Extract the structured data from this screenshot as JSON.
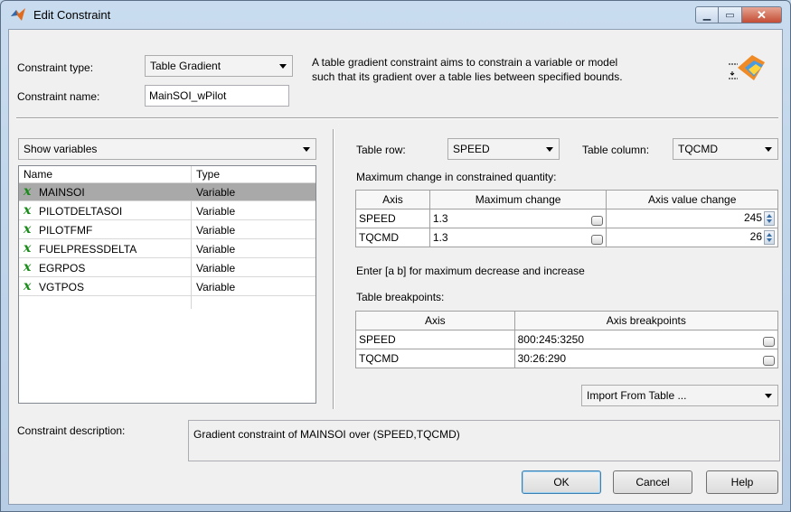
{
  "window": {
    "title": "Edit Constraint"
  },
  "header": {
    "constraint_type_label": "Constraint type:",
    "constraint_type_value": "Table Gradient",
    "constraint_name_label": "Constraint name:",
    "constraint_name_value": "MainSOI_wPilot",
    "description_line1": "A table gradient constraint aims to constrain a variable or model",
    "description_line2": "such that its gradient over a table lies between specified bounds."
  },
  "left_panel": {
    "filter_value": "Show variables",
    "columns": [
      "Name",
      "Type"
    ],
    "variables": [
      {
        "name": "MAINSOI",
        "type": "Variable",
        "selected": true
      },
      {
        "name": "PILOTDELTASOI",
        "type": "Variable"
      },
      {
        "name": "PILOTFMF",
        "type": "Variable"
      },
      {
        "name": "FUELPRESSDELTA",
        "type": "Variable"
      },
      {
        "name": "EGRPOS",
        "type": "Variable"
      },
      {
        "name": "VGTPOS",
        "type": "Variable"
      }
    ]
  },
  "right_panel": {
    "table_row_label": "Table row:",
    "table_row_value": "SPEED",
    "table_column_label": "Table column:",
    "table_column_value": "TQCMD",
    "max_change_label": "Maximum change in constrained quantity:",
    "max_change_table": {
      "headers": [
        "Axis",
        "Maximum change",
        "Axis value change"
      ],
      "rows": [
        {
          "axis": "SPEED",
          "max_change": "1.3",
          "axis_value_change": "245"
        },
        {
          "axis": "TQCMD",
          "max_change": "1.3",
          "axis_value_change": "26"
        }
      ]
    },
    "hint": "Enter [a b] for maximum decrease and increase",
    "breakpoints_label": "Table breakpoints:",
    "breakpoints_table": {
      "headers": [
        "Axis",
        "Axis breakpoints"
      ],
      "rows": [
        {
          "axis": "SPEED",
          "breakpoints": "800:245:3250"
        },
        {
          "axis": "TQCMD",
          "breakpoints": "30:26:290"
        }
      ]
    },
    "import_value": "Import From Table ..."
  },
  "footer": {
    "description_label": "Constraint description:",
    "description_value": "Gradient constraint of MAINSOI over (SPEED,TQCMD)",
    "ok": "OK",
    "cancel": "Cancel",
    "help": "Help"
  }
}
